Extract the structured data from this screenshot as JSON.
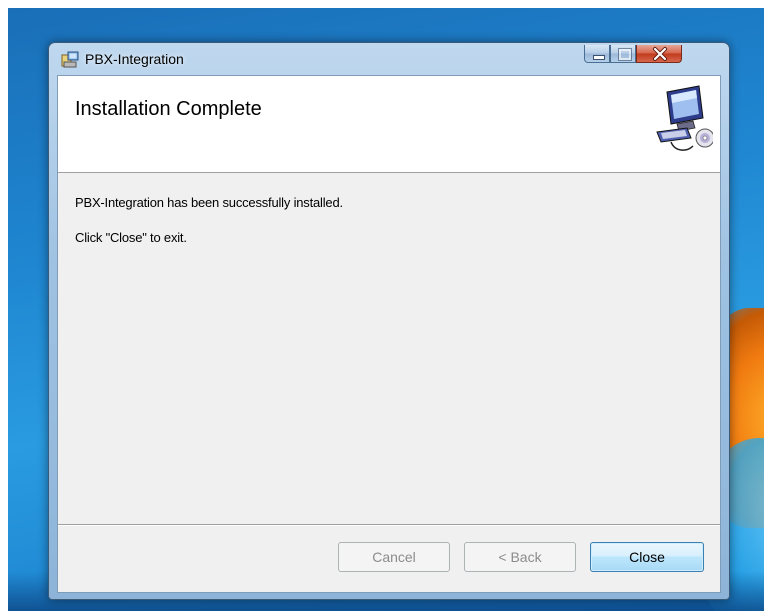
{
  "window": {
    "title": "PBX-Integration"
  },
  "banner": {
    "title": "Installation Complete",
    "icon": "installer-computer-cd-icon"
  },
  "body": {
    "message_1": "PBX-Integration has been successfully installed.",
    "message_2": "Click \"Close\" to exit."
  },
  "buttons": {
    "cancel": "Cancel",
    "back": "< Back",
    "close": "Close"
  },
  "colors": {
    "accent_button_border": "#3c7fb1",
    "close_caption_red": "#c1391c",
    "desktop_blue": "#1f86d1"
  }
}
